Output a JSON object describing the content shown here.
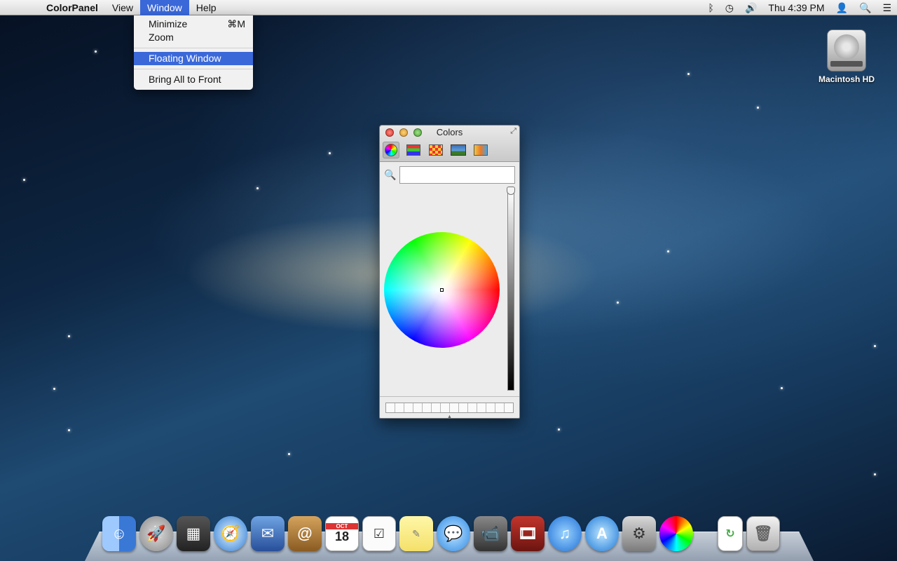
{
  "menubar": {
    "app_name": "ColorPanel",
    "menus": [
      "View",
      "Window",
      "Help"
    ],
    "clock": "Thu 4:39 PM"
  },
  "window_menu": {
    "items": [
      {
        "label": "Minimize",
        "shortcut": "⌘M"
      },
      {
        "label": "Zoom",
        "shortcut": ""
      },
      {
        "label": "Floating Window",
        "shortcut": ""
      },
      {
        "label": "Bring All to Front",
        "shortcut": ""
      }
    ]
  },
  "desktop": {
    "drive_label": "Macintosh HD"
  },
  "colors_panel": {
    "title": "Colors",
    "search_value": ""
  },
  "calendar_icon": {
    "month": "OCT",
    "day": "18"
  },
  "accent_color": "#3b68d9"
}
